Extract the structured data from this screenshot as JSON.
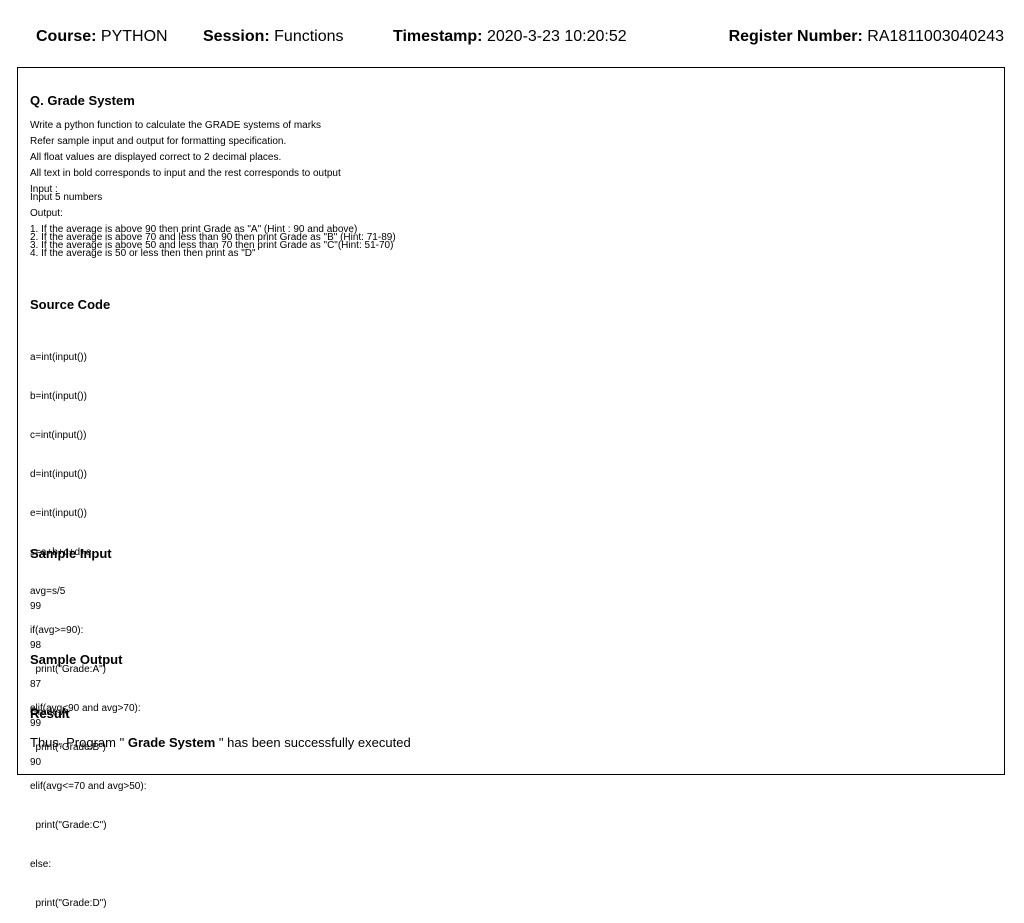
{
  "header": {
    "course_label": "Course:",
    "course_value": "PYTHON",
    "session_label": "Session:",
    "session_value": "Functions",
    "timestamp_label": "Timestamp:",
    "timestamp_value": "2020-3-23 10:20:52",
    "register_label": "Register Number:",
    "register_value": "RA1811003040243"
  },
  "question": {
    "title": "Q. Grade System",
    "lines": [
      "Write a python function to calculate the GRADE systems of marks",
      "Refer sample input and output for formatting specification.",
      "All float values are displayed correct to 2 decimal places.",
      "All text in bold corresponds to input and the rest corresponds to output"
    ],
    "input_label": "Input :",
    "input_desc": "Input 5 numbers",
    "output_label": "Output:",
    "output_rules": [
      "1. If the average is above 90 then print Grade as \"A\" (Hint : 90 and above)",
      "2. If the average is above 70 and less than 90 then print Grade as \"B\" (Hint: 71-89)",
      "3. If the average is above 50 and less than 70 then print Grade as \"C\"(Hint: 51-70)",
      "4. If the average is 50 or less then then print as \"D\""
    ]
  },
  "source": {
    "title": "Source Code",
    "lines": [
      "a=int(input())",
      "b=int(input())",
      "c=int(input())",
      "d=int(input())",
      "e=int(input())",
      "s=a+b+c+d+e",
      "avg=s/5",
      "if(avg>=90):",
      "  print(\"Grade:A\")",
      "elif(avg<90 and avg>70):",
      "  print(\"Grade:B\")",
      "elif(avg<=70 and avg>50):",
      "  print(\"Grade:C\")",
      "else:",
      "  print(\"Grade:D\")"
    ]
  },
  "sample_input": {
    "title": "Sample Input",
    "lines": [
      "99",
      "98",
      "87",
      "99",
      "90"
    ]
  },
  "sample_output": {
    "title": "Sample Output",
    "lines": [
      "Grade:A"
    ]
  },
  "result": {
    "title": "Result",
    "prefix": "Thus, Program \"",
    "program_name": "Grade System",
    "suffix": "\" has been successfully executed"
  }
}
